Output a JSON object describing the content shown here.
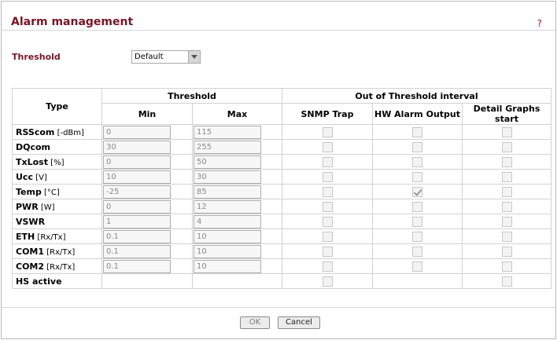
{
  "header": {
    "title": "Alarm management",
    "help": "?"
  },
  "threshold_selector": {
    "label": "Threshold",
    "value": "Default"
  },
  "table": {
    "col_type": "Type",
    "group_threshold": "Threshold",
    "group_out": "Out of Threshold interval",
    "col_min": "Min",
    "col_max": "Max",
    "col_snmp": "SNMP Trap",
    "col_hw": "HW Alarm Output",
    "col_graphs": "Detail Graphs start",
    "rows": [
      {
        "name": "RSScom",
        "unit": "[-dBm]",
        "min": "0",
        "max": "115",
        "snmp": false,
        "hw": false,
        "graphs": false
      },
      {
        "name": "DQcom",
        "unit": "",
        "min": "30",
        "max": "255",
        "snmp": false,
        "hw": false,
        "graphs": false
      },
      {
        "name": "TxLost",
        "unit": "[%]",
        "min": "0",
        "max": "50",
        "snmp": false,
        "hw": false,
        "graphs": false
      },
      {
        "name": "Ucc",
        "unit": "[V]",
        "min": "10",
        "max": "30",
        "snmp": false,
        "hw": false,
        "graphs": false
      },
      {
        "name": "Temp",
        "unit": "[°C]",
        "min": "-25",
        "max": "85",
        "snmp": false,
        "hw": true,
        "graphs": false
      },
      {
        "name": "PWR",
        "unit": "[W]",
        "min": "0",
        "max": "12",
        "snmp": false,
        "hw": false,
        "graphs": false
      },
      {
        "name": "VSWR",
        "unit": "",
        "min": "1",
        "max": "4",
        "snmp": false,
        "hw": false,
        "graphs": false
      },
      {
        "name": "ETH",
        "unit": "[Rx/Tx]",
        "min": "0.1",
        "max": "10",
        "snmp": false,
        "hw": false,
        "graphs": false
      },
      {
        "name": "COM1",
        "unit": "[Rx/Tx]",
        "min": "0.1",
        "max": "10",
        "snmp": false,
        "hw": false,
        "graphs": false
      },
      {
        "name": "COM2",
        "unit": "[Rx/Tx]",
        "min": "0.1",
        "max": "10",
        "snmp": false,
        "hw": false,
        "graphs": false
      },
      {
        "name": "HS active",
        "unit": "",
        "min": null,
        "max": null,
        "snmp": false,
        "hw": null,
        "graphs": false
      }
    ]
  },
  "buttons": {
    "ok": "OK",
    "cancel": "Cancel"
  }
}
